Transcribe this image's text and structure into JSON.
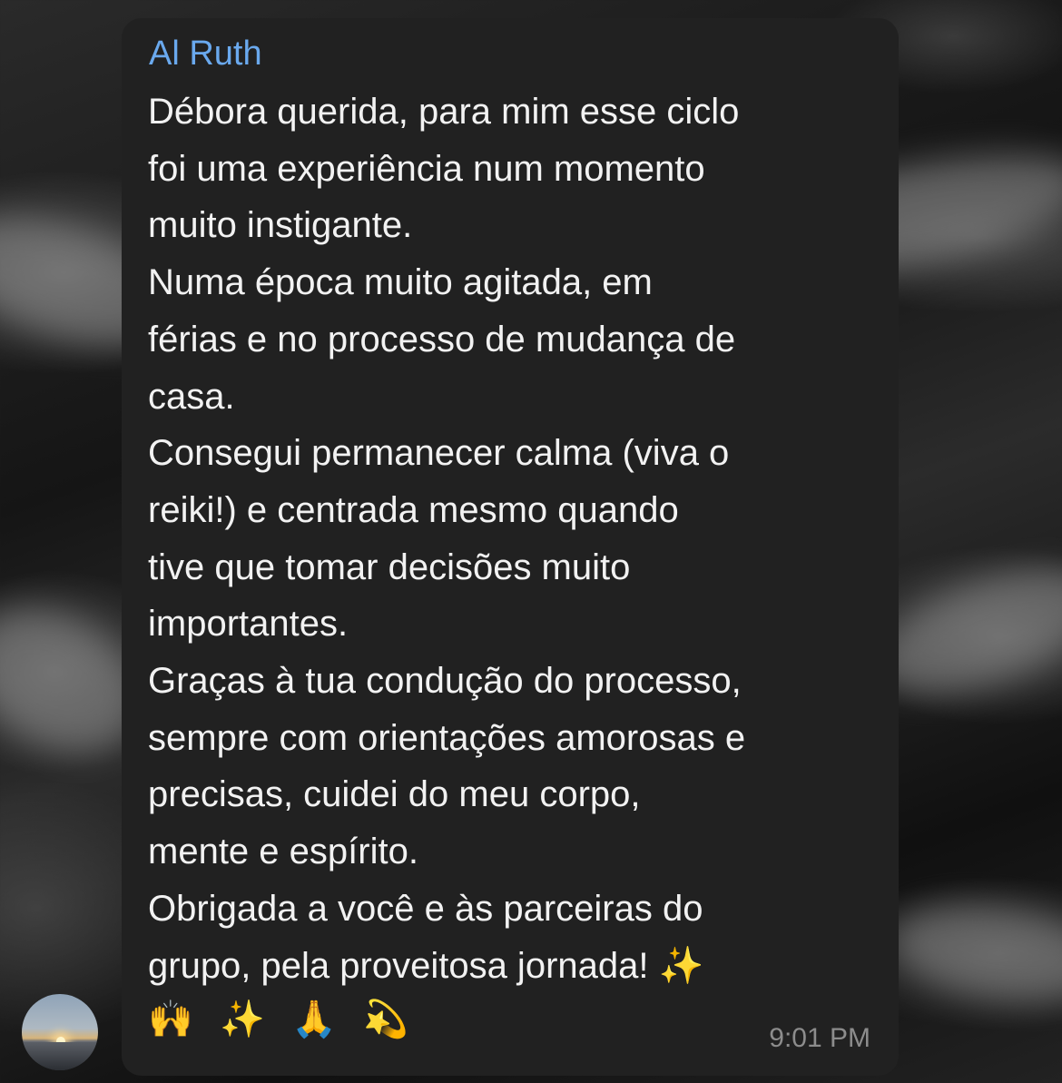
{
  "chat": {
    "sender_name": "Al Ruth",
    "message_lines": [
      "Débora querida, para mim esse ciclo",
      "foi uma experiência num momento",
      "muito instigante.",
      "Numa época muito agitada, em",
      "férias e no processo de mudança de",
      "casa.",
      "Consegui permanecer calma (viva o",
      "reiki!) e centrada mesmo quando",
      "tive que tomar decisões muito",
      "importantes.",
      "Graças à tua condução do processo,",
      "sempre com orientações amorosas e",
      "precisas, cuidei do meu corpo,",
      "mente e espírito.",
      "Obrigada a você e às parceiras do",
      "grupo, pela proveitosa jornada! ✨"
    ],
    "emojis": [
      "🙌",
      "✨",
      "🙏",
      "💫"
    ],
    "timestamp": "9:01 PM",
    "avatar_icon": "sunset-over-sea-avatar"
  },
  "colors": {
    "sender_name": "#6aa9ee",
    "bubble_background": "#212121",
    "message_text": "#f2f2f2",
    "timestamp": "#8c8c8c"
  }
}
